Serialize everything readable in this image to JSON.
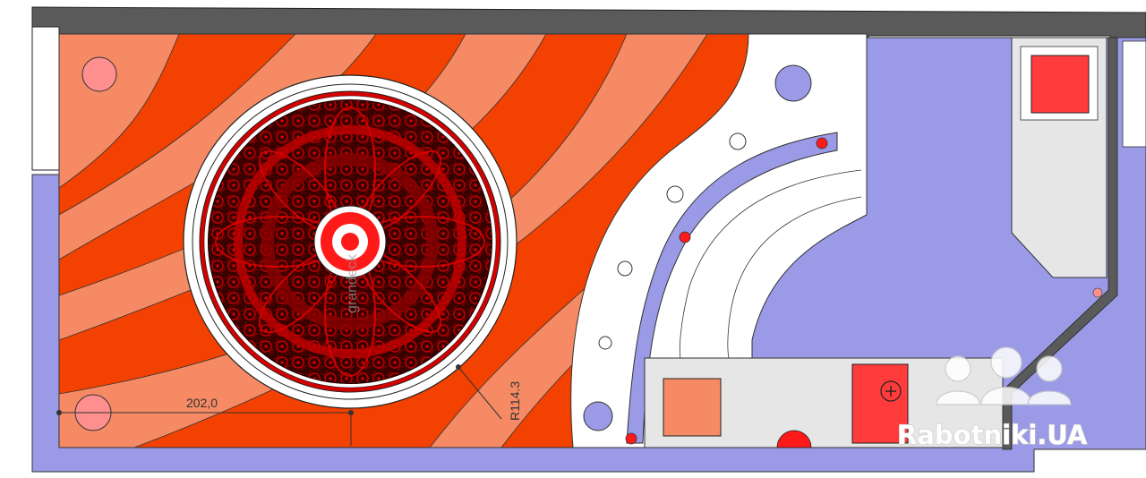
{
  "drawing": {
    "dimension_linear": "202,0",
    "dimension_radius": "R114.3",
    "medallion_stamp": "grandeck"
  },
  "watermark": {
    "text": "Rabotniki.UA",
    "icon": "workers-helmet-icon"
  },
  "colors": {
    "wall": "#5a5a5a",
    "floor_blue": "#9a9ae6",
    "light_band": "#f58a64",
    "dark_band": "#f24100",
    "medallion_dark": "#2a0000",
    "medallion_red": "#c40000",
    "accent_red": "#ff3b3b",
    "salmon_lamp": "#ff8f8f",
    "panel_gray": "#e6e6e6"
  },
  "symbols": {
    "socket": "plus-circle-icon"
  }
}
